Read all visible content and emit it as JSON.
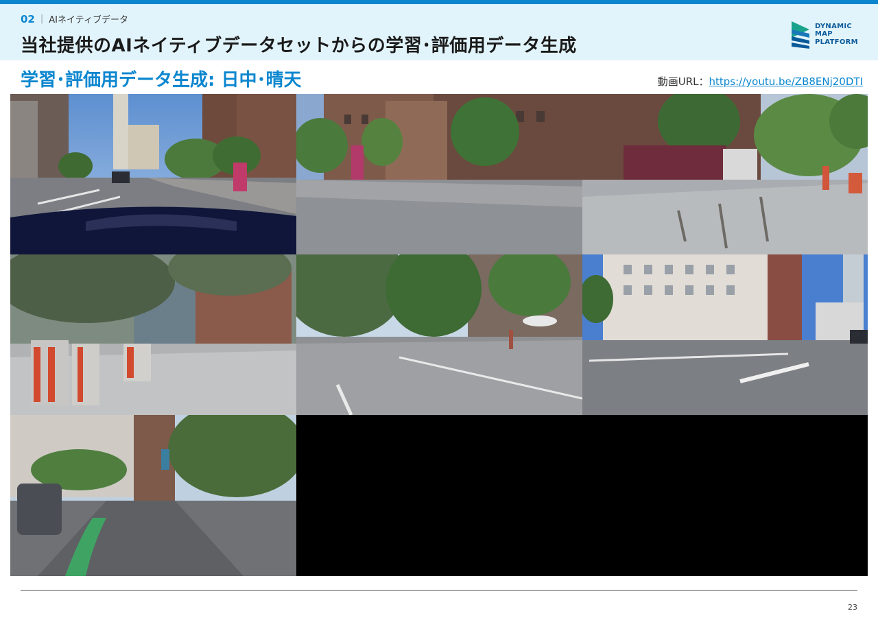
{
  "header": {
    "section_number": "02",
    "section_separator": "|",
    "section_name": "AIネイティブデータ",
    "title": "当社提供のAIネイティブデータセットからの学習･評価用データ生成"
  },
  "logo": {
    "line1": "DYNAMIC",
    "line2": "MAP",
    "line3": "PLATFORM"
  },
  "subtitle": "学習･評価用データ生成: 日中･晴天",
  "video": {
    "label": "動画URL：",
    "url": "https://youtu.be/ZB8ENj20DTI"
  },
  "frames": [
    {
      "scene": "city street with tall tower and sidewalk advertising kiosk, dashboard visible"
    },
    {
      "scene": "brick buildings, trees and sidewalk with low barrier"
    },
    {
      "scene": "parked truck, bollards and pedestrian on sunny sidewalk"
    },
    {
      "scene": "orange construction barriers under trees"
    },
    {
      "scene": "wide intersection lined with trees and kiosk"
    },
    {
      "scene": "multi-lane road with white office buildings and tower"
    },
    {
      "scene": "green bike lane, parked SUV and tree-lined avenue"
    }
  ],
  "footer": {
    "page_number": "23"
  },
  "colors": {
    "accent": "#0a86cf",
    "header_bg": "#e2f4fb",
    "logo_green": "#19a38c",
    "logo_blue": "#0b5a9a"
  }
}
